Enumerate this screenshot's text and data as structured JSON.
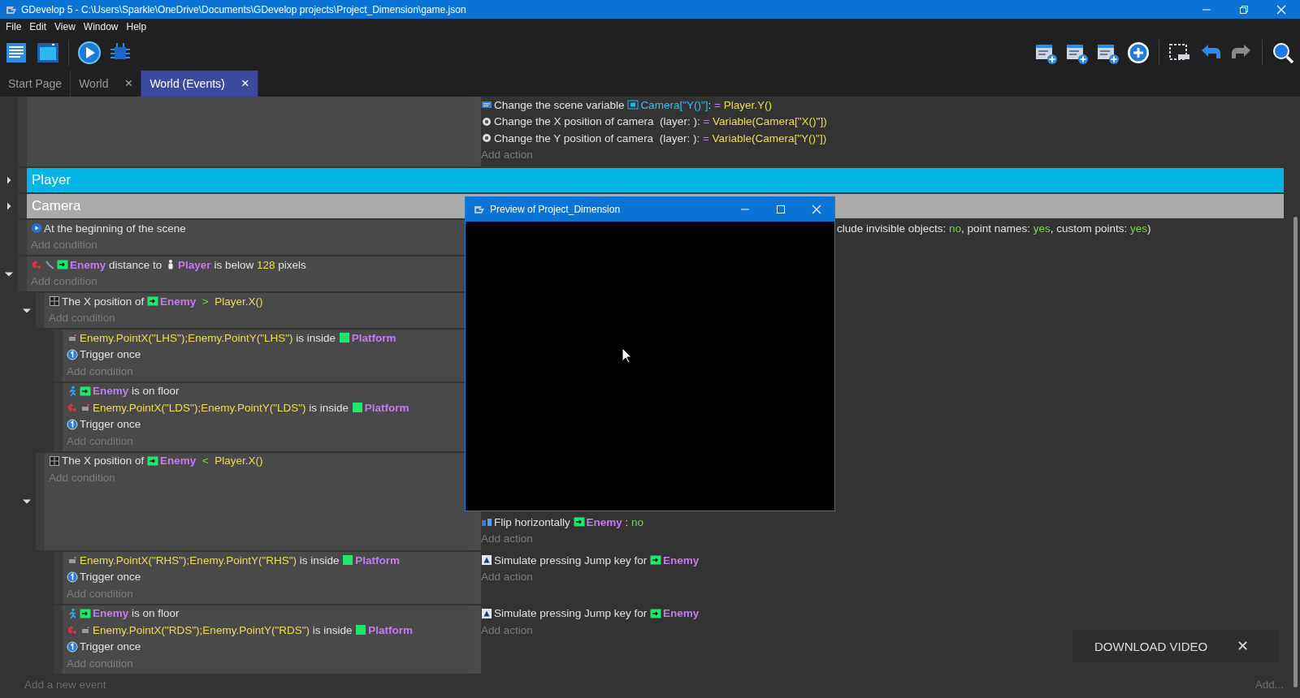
{
  "window": {
    "title": "GDevelop 5 - C:\\Users\\Sparkle\\OneDrive\\Documents\\GDevelop projects\\Project_Dimension\\game.json"
  },
  "menu": [
    "File",
    "Edit",
    "View",
    "Window",
    "Help"
  ],
  "tabs": [
    {
      "label": "Start Page",
      "selected": false
    },
    {
      "label": "World",
      "selected": false,
      "close": "×"
    },
    {
      "label": "World (Events)",
      "selected": true,
      "close": "×"
    }
  ],
  "events": [
    {
      "kind": "event",
      "actions": [
        {
          "parts": [
            {
              "kind": "scene-variable"
            },
            {
              "text": "Change the scene variable ",
              "kind": "plain"
            },
            {
              "kind": "variable-ref"
            },
            {
              "text": "Camera[\"Y()\"]",
              "kind": "variable"
            },
            {
              "text": ": ",
              "kind": "plain"
            },
            {
              "text": "=",
              "kind": "assign"
            },
            {
              "text": " Player.Y()",
              "kind": "expr"
            }
          ]
        },
        {
          "parts": [
            {
              "kind": "camera"
            },
            {
              "text": "Change the X position of camera  (layer: ): ",
              "kind": "plain"
            },
            {
              "text": "=",
              "kind": "assign"
            },
            {
              "text": " Variable(Camera[\"X()\"])",
              "kind": "expr"
            }
          ]
        },
        {
          "parts": [
            {
              "kind": "camera"
            },
            {
              "text": "Change the Y position of camera  (layer: ): ",
              "kind": "plain"
            },
            {
              "text": "=",
              "kind": "assign"
            },
            {
              "text": " Variable(Camera[\"Y()\"])",
              "kind": "expr"
            }
          ]
        },
        {
          "parts": [
            {
              "text": "Add action",
              "kind": "add"
            }
          ]
        }
      ]
    },
    {
      "kind": "group",
      "title": "Player",
      "color": "#00b4e6",
      "expanded": false
    },
    {
      "kind": "group",
      "title": "Camera",
      "color": "#aaaaaa",
      "expanded": false
    },
    {
      "kind": "event",
      "conditions": [
        {
          "parts": [
            {
              "kind": "scene-start"
            },
            {
              "text": "At the beginning of the scene",
              "kind": "plain"
            }
          ]
        },
        {
          "parts": [
            {
              "text": "Add condition",
              "kind": "add"
            }
          ]
        }
      ],
      "actions": [
        {
          "parts": [
            {
              "text": "clude invisible objects: ",
              "kind": "plain"
            },
            {
              "text": "no",
              "kind": "value"
            },
            {
              "text": ", point names: ",
              "kind": "plain"
            },
            {
              "text": "yes",
              "kind": "value"
            },
            {
              "text": ", custom points: ",
              "kind": "plain"
            },
            {
              "text": "yes",
              "kind": "value"
            },
            {
              "text": ")",
              "kind": "plain"
            }
          ]
        }
      ]
    },
    {
      "kind": "event",
      "expanded": true,
      "conditions": [
        {
          "parts": [
            {
              "kind": "distance"
            },
            {
              "kind": "distance-tool"
            },
            {
              "kind": "sprite-object"
            },
            {
              "text": "Enemy",
              "kind": "object"
            },
            {
              "text": " distance to ",
              "kind": "plain"
            },
            {
              "kind": "player-object"
            },
            {
              "text": "Player",
              "kind": "object"
            },
            {
              "text": " is below ",
              "kind": "plain"
            },
            {
              "text": "128",
              "kind": "expr"
            },
            {
              "text": " pixels",
              "kind": "plain"
            }
          ]
        },
        {
          "parts": [
            {
              "text": "Add condition",
              "kind": "add"
            }
          ]
        }
      ],
      "children": [
        {
          "kind": "event",
          "expanded": true,
          "conditions": [
            {
              "parts": [
                {
                  "kind": "position"
                },
                {
                  "text": "The X position of ",
                  "kind": "plain"
                },
                {
                  "kind": "sprite-object"
                },
                {
                  "text": "Enemy",
                  "kind": "object"
                },
                {
                  "text": "  >  ",
                  "kind": "op"
                },
                {
                  "text": "Player.X()",
                  "kind": "expr"
                }
              ]
            },
            {
              "parts": [
                {
                  "text": "Add condition",
                  "kind": "add"
                }
              ]
            }
          ],
          "children": [
            {
              "kind": "event",
              "conditions": [
                {
                  "parts": [
                    {
                      "kind": "point-inside"
                    },
                    {
                      "text": "Enemy.PointX(\"LHS\");Enemy.PointY(\"LHS\")",
                      "kind": "expr"
                    },
                    {
                      "text": " is inside ",
                      "kind": "plain"
                    },
                    {
                      "kind": "tiled-object"
                    },
                    {
                      "text": "Platform",
                      "kind": "object"
                    }
                  ]
                },
                {
                  "parts": [
                    {
                      "kind": "trigger-once"
                    },
                    {
                      "text": "Trigger once",
                      "kind": "plain"
                    }
                  ]
                },
                {
                  "parts": [
                    {
                      "text": "Add condition",
                      "kind": "add"
                    }
                  ]
                }
              ]
            },
            {
              "kind": "event",
              "conditions": [
                {
                  "parts": [
                    {
                      "kind": "platformer"
                    },
                    {
                      "kind": "sprite-object"
                    },
                    {
                      "text": "Enemy",
                      "kind": "object"
                    },
                    {
                      "text": " is on floor",
                      "kind": "plain"
                    }
                  ]
                },
                {
                  "parts": [
                    {
                      "kind": "distance"
                    },
                    {
                      "kind": "point-inside"
                    },
                    {
                      "text": "Enemy.PointX(\"LDS\");Enemy.PointY(\"LDS\")",
                      "kind": "expr"
                    },
                    {
                      "text": " is inside ",
                      "kind": "plain"
                    },
                    {
                      "kind": "tiled-object"
                    },
                    {
                      "text": "Platform",
                      "kind": "object"
                    }
                  ]
                },
                {
                  "parts": [
                    {
                      "kind": "trigger-once"
                    },
                    {
                      "text": "Trigger once",
                      "kind": "plain"
                    }
                  ]
                },
                {
                  "parts": [
                    {
                      "text": "Add condition",
                      "kind": "add"
                    }
                  ]
                }
              ]
            }
          ]
        },
        {
          "kind": "event",
          "expanded": true,
          "conditions": [
            {
              "parts": [
                {
                  "kind": "position"
                },
                {
                  "text": "The X position of ",
                  "kind": "plain"
                },
                {
                  "kind": "sprite-object"
                },
                {
                  "text": "Enemy",
                  "kind": "object"
                },
                {
                  "text": "  <  ",
                  "kind": "op"
                },
                {
                  "text": "Player.X()",
                  "kind": "expr"
                }
              ]
            },
            {
              "parts": [
                {
                  "text": "Add condition",
                  "kind": "add"
                }
              ]
            }
          ],
          "actions": [
            {
              "parts": [
                {
                  "kind": "flip"
                },
                {
                  "text": "Flip horizontally ",
                  "kind": "plain"
                },
                {
                  "kind": "sprite-object"
                },
                {
                  "text": "Enemy",
                  "kind": "object"
                },
                {
                  "text": " : ",
                  "kind": "plain"
                },
                {
                  "text": "no",
                  "kind": "value"
                }
              ]
            },
            {
              "parts": [
                {
                  "text": "Add action",
                  "kind": "add"
                }
              ]
            }
          ],
          "children": [
            {
              "kind": "event",
              "conditions": [
                {
                  "parts": [
                    {
                      "kind": "point-inside"
                    },
                    {
                      "text": "Enemy.PointX(\"RHS\");Enemy.PointY(\"RHS\")",
                      "kind": "expr"
                    },
                    {
                      "text": " is inside ",
                      "kind": "plain"
                    },
                    {
                      "kind": "tiled-object"
                    },
                    {
                      "text": "Platform",
                      "kind": "object"
                    }
                  ]
                },
                {
                  "parts": [
                    {
                      "kind": "trigger-once"
                    },
                    {
                      "text": "Trigger once",
                      "kind": "plain"
                    }
                  ]
                },
                {
                  "parts": [
                    {
                      "text": "Add condition",
                      "kind": "add"
                    }
                  ]
                }
              ],
              "actions": [
                {
                  "parts": [
                    {
                      "kind": "simulate-key"
                    },
                    {
                      "text": "Simulate pressing Jump key for ",
                      "kind": "plain"
                    },
                    {
                      "kind": "sprite-object"
                    },
                    {
                      "text": "Enemy",
                      "kind": "object"
                    }
                  ]
                },
                {
                  "parts": [
                    {
                      "text": "Add action",
                      "kind": "add"
                    }
                  ]
                }
              ]
            },
            {
              "kind": "event",
              "conditions": [
                {
                  "parts": [
                    {
                      "kind": "platformer"
                    },
                    {
                      "kind": "sprite-object"
                    },
                    {
                      "text": "Enemy",
                      "kind": "object"
                    },
                    {
                      "text": " is on floor",
                      "kind": "plain"
                    }
                  ]
                },
                {
                  "parts": [
                    {
                      "kind": "distance"
                    },
                    {
                      "kind": "point-inside"
                    },
                    {
                      "text": "Enemy.PointX(\"RDS\");Enemy.PointY(\"RDS\")",
                      "kind": "expr"
                    },
                    {
                      "text": " is inside ",
                      "kind": "plain"
                    },
                    {
                      "kind": "tiled-object"
                    },
                    {
                      "text": "Platform",
                      "kind": "object"
                    }
                  ]
                },
                {
                  "parts": [
                    {
                      "kind": "trigger-once"
                    },
                    {
                      "text": "Trigger once",
                      "kind": "plain"
                    }
                  ]
                },
                {
                  "parts": [
                    {
                      "text": "Add condition",
                      "kind": "add"
                    }
                  ]
                }
              ],
              "actions": [
                {
                  "parts": [
                    {
                      "kind": "simulate-key"
                    },
                    {
                      "text": "Simulate pressing Jump key for ",
                      "kind": "plain"
                    },
                    {
                      "kind": "sprite-object"
                    },
                    {
                      "text": "Enemy",
                      "kind": "object"
                    }
                  ]
                },
                {
                  "parts": [
                    {
                      "text": "Add action",
                      "kind": "add"
                    }
                  ]
                }
              ]
            }
          ]
        }
      ]
    }
  ],
  "add_event": "Add a new event",
  "add_more": "Add...",
  "preview": {
    "title": "Preview of Project_Dimension"
  },
  "toast": {
    "label": "DOWNLOAD VIDEO",
    "close": "✕"
  }
}
